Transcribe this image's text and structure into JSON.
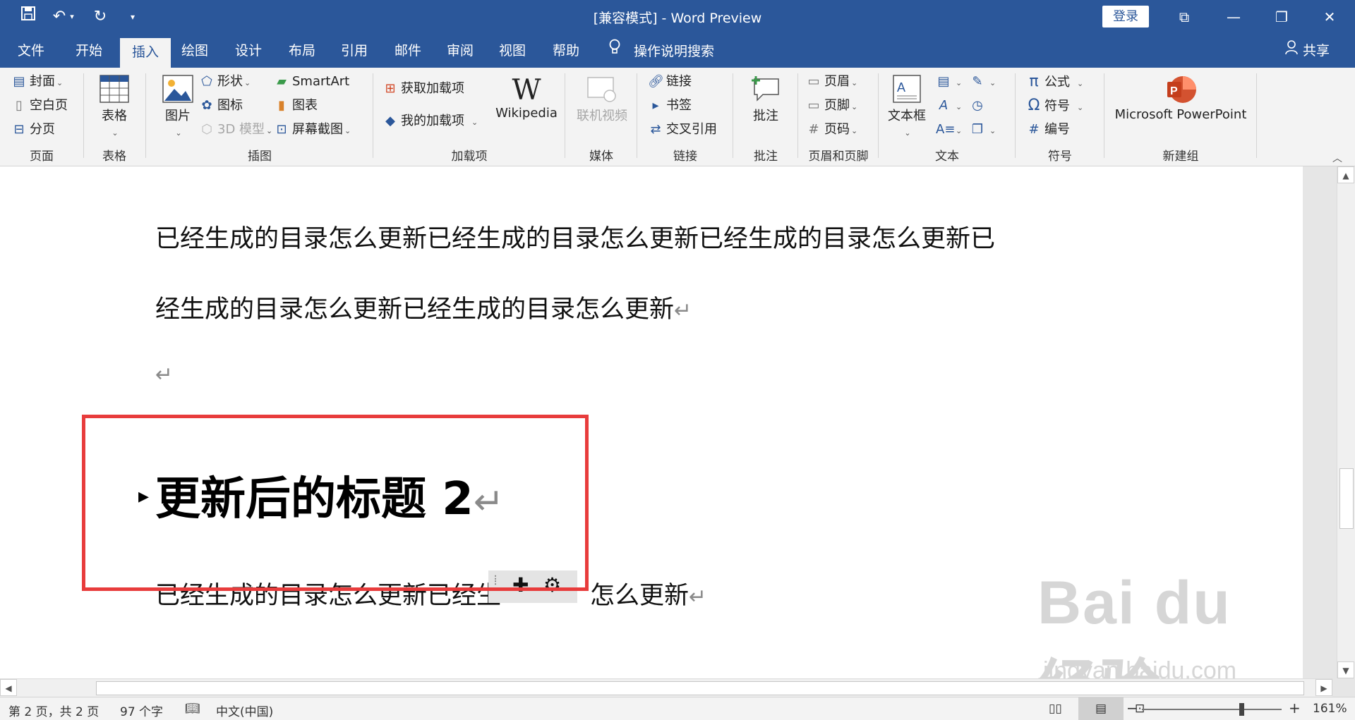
{
  "title_bar": {
    "title": "[兼容模式]  -  Word Preview",
    "login_label": "登录"
  },
  "tabs": [
    {
      "label": "文件"
    },
    {
      "label": "开始"
    },
    {
      "label": "插入",
      "active": true
    },
    {
      "label": "绘图"
    },
    {
      "label": "设计"
    },
    {
      "label": "布局"
    },
    {
      "label": "引用"
    },
    {
      "label": "邮件"
    },
    {
      "label": "审阅"
    },
    {
      "label": "视图"
    },
    {
      "label": "帮助"
    }
  ],
  "tell_me": "操作说明搜索",
  "share": "共享",
  "ribbon": {
    "pages": {
      "label": "页面",
      "cover": "封面",
      "blank_page": "空白页",
      "page_break": "分页"
    },
    "tables": {
      "label": "表格",
      "table": "表格"
    },
    "illustrations": {
      "label": "插图",
      "pictures": "图片",
      "shapes": "形状",
      "icons": "图标",
      "models_3d": "3D 模型",
      "smartart": "SmartArt",
      "chart": "图表",
      "screenshot": "屏幕截图"
    },
    "addins": {
      "label": "加载项",
      "get_addins": "获取加载项",
      "my_addins": "我的加载项",
      "wikipedia": "Wikipedia"
    },
    "media": {
      "label": "媒体",
      "online_video": "联机视频"
    },
    "links": {
      "label": "链接",
      "link": "链接",
      "bookmark": "书签",
      "cross_ref": "交叉引用"
    },
    "comments": {
      "label": "批注",
      "comment": "批注"
    },
    "header_footer": {
      "label": "页眉和页脚",
      "header": "页眉",
      "footer": "页脚",
      "page_number": "页码"
    },
    "text": {
      "label": "文本",
      "text_box": "文本框"
    },
    "symbols": {
      "label": "符号",
      "equation": "公式",
      "symbol": "符号",
      "number": "编号"
    },
    "new_group": {
      "label": "新建组",
      "powerpoint": "Microsoft PowerPoint"
    }
  },
  "document": {
    "para1_line1": "已经生成的目录怎么更新已经生成的目录怎么更新已经生成的目录怎么更新已",
    "para1_line2": "经生成的目录怎么更新已经生成的目录怎么更新",
    "heading": "更新后的标题 2",
    "para2_before": "已经生成的目录怎么更新已经生",
    "para2_after": "怎么更新",
    "para_mark": "↵"
  },
  "watermark": {
    "brand": "Bai du 经验",
    "url": "jingyan.baidu.com"
  },
  "status_bar": {
    "page": "第 2 页，共 2 页",
    "words": "97 个字",
    "language": "中文(中国)",
    "zoom": "161%"
  },
  "colors": {
    "accent": "#2b579a",
    "highlight_box": "#e83c3c"
  }
}
